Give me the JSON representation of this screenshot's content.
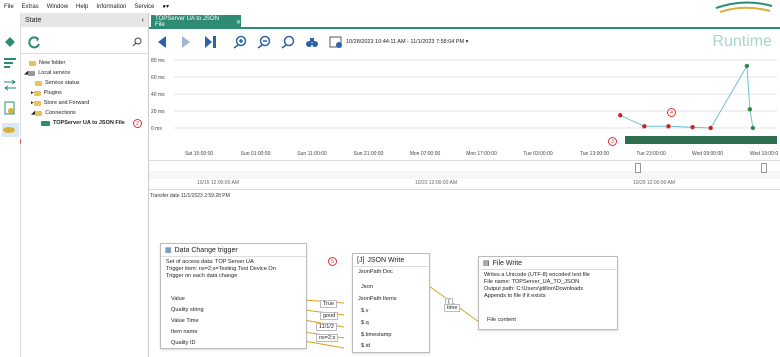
{
  "menu": [
    "File",
    "Extras",
    "Window",
    "Help",
    "Information",
    "Service"
  ],
  "state": {
    "title": "State",
    "tree": [
      "New folder",
      "Local service",
      "Service status",
      "Plugins",
      "Store and Forward",
      "Connections",
      "TOPServer UA to JSON File"
    ]
  },
  "tab": {
    "title": "TOPServer UA to JSON File"
  },
  "toolbar": {
    "date_range": "10/28/2023 10:44:11 AM - 11/1/2023 7:58:04 PM",
    "mode": "Runtime"
  },
  "chart_data": {
    "type": "scatter",
    "ylabel": "",
    "y_ticks": [
      "0 ms",
      "20 ms",
      "40 ms",
      "60 ms",
      "80 ms"
    ],
    "ylim": [
      0,
      80
    ],
    "x_ticks": [
      "Sat 15:00:00",
      "Sun 01:00:00",
      "Sun 11:00:00",
      "Sun 21:00:00",
      "Mon 07:00:00",
      "Mon 17:00:00",
      "Tue 03:00:00",
      "Tue 13:00:00",
      "Tue 23:00:00",
      "Wed 09:00:00",
      "Wed 19:00:0"
    ],
    "series": [
      {
        "points": [
          [
            0.74,
            15
          ],
          [
            0.78,
            2
          ],
          [
            0.82,
            2
          ],
          [
            0.86,
            1
          ],
          [
            0.89,
            0
          ],
          [
            0.95,
            73
          ],
          [
            0.955,
            22
          ],
          [
            0.96,
            0
          ]
        ]
      }
    ],
    "grid": true
  },
  "timeline": {
    "labels": [
      "10/15 12:00:00 AM",
      "10/22 12:00:00 AM",
      "10/29 12:00:00 AM"
    ]
  },
  "transfer": "Transfer date  11/1/2023 2:59:28 PM",
  "nodes": {
    "trigger": {
      "title": "Data Change trigger",
      "lines": [
        "Set of access data: TOP Server UA",
        "Trigger item: ns=2;s=Testing.Test Device.On",
        "Trigger on each data change"
      ],
      "ports": [
        "Value",
        "Quality string",
        "Value Time",
        "Item name",
        "Quality ID"
      ]
    },
    "jsonwrite": {
      "title": "JSON Write",
      "lines": [
        "JsonPath Doc"
      ],
      "json": "Json",
      "items_label": "JsonPath Items",
      "items": [
        "$.v",
        "$.q",
        "$.timestamp",
        "$.id"
      ]
    },
    "filewrite": {
      "title": "File Write",
      "lines": [
        "Writes a Unicode (UTF-8) encoded text file",
        "File name: TOPServer_UA_TO_JSON",
        "Output path: C:\\Users\\jdillon\\Downloads",
        "Appends to file if it exists"
      ],
      "content": "File content"
    }
  },
  "values": [
    "True",
    "good",
    "11/1/2",
    "ns=2;s",
    "{",
    "time"
  ],
  "badges": [
    "1",
    "2",
    "3",
    "4",
    "5"
  ]
}
